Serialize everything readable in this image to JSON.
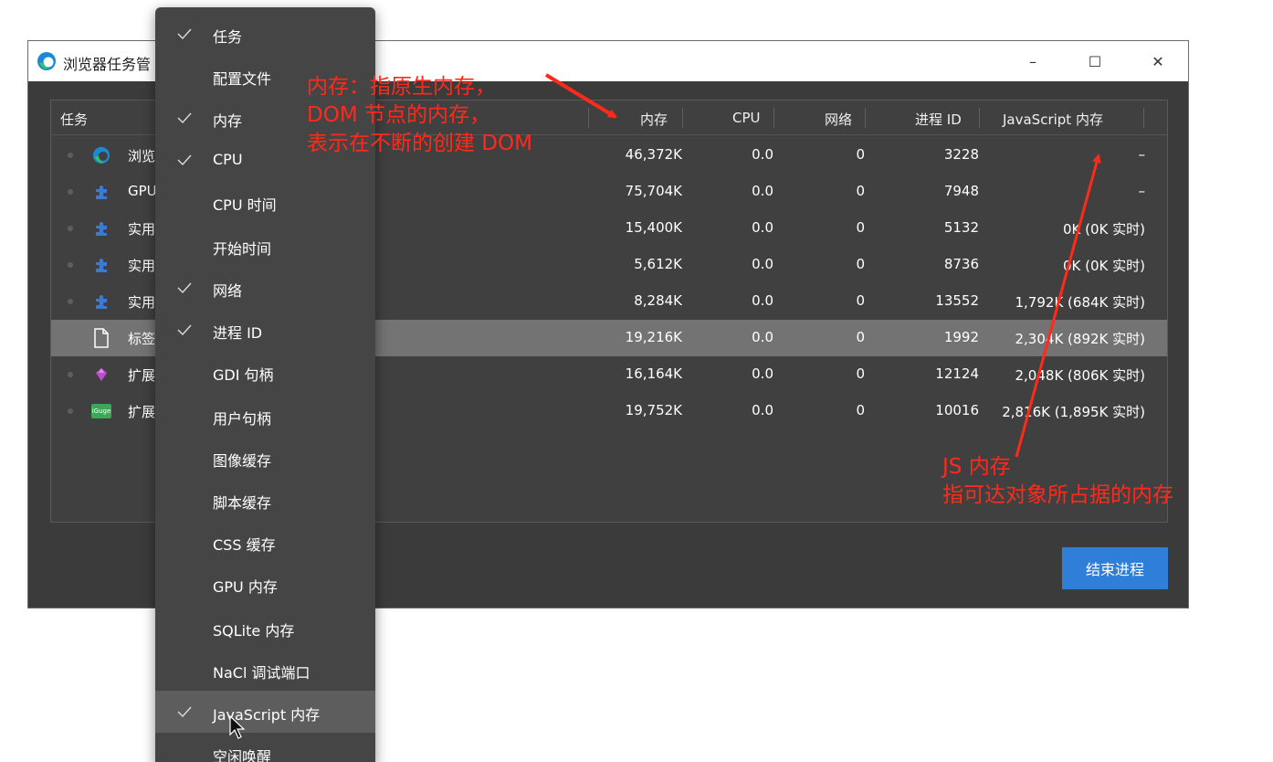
{
  "window": {
    "title": "浏览器任务管",
    "controls": {
      "minimize": "–",
      "maximize": "☐",
      "close": "✕"
    }
  },
  "table": {
    "headers": {
      "task": "任务",
      "memory": "内存",
      "cpu": "CPU",
      "network": "网络",
      "pid": "进程 ID",
      "js_memory": "JavaScript 内存"
    },
    "rows": [
      {
        "task": "浏览",
        "icon": "edge-icon",
        "memory": "46,372K",
        "cpu": "0.0",
        "network": "0",
        "pid": "3228",
        "js": "–"
      },
      {
        "task": "GPU",
        "icon": "puzzle-icon",
        "memory": "75,704K",
        "cpu": "0.0",
        "network": "0",
        "pid": "7948",
        "js": "–"
      },
      {
        "task": "实用",
        "icon": "puzzle-icon",
        "memory": "15,400K",
        "cpu": "0.0",
        "network": "0",
        "pid": "5132",
        "js": "0K (0K 实时)"
      },
      {
        "task": "实用",
        "icon": "puzzle-icon",
        "memory": "5,612K",
        "cpu": "0.0",
        "network": "0",
        "pid": "8736",
        "js": "0K (0K 实时)"
      },
      {
        "task": "实用",
        "icon": "puzzle-icon",
        "memory": "8,284K",
        "cpu": "0.0",
        "network": "0",
        "pid": "13552",
        "js": "1,792K (684K 实时)"
      },
      {
        "task": "标签",
        "icon": "page-icon",
        "memory": "19,216K",
        "cpu": "0.0",
        "network": "0",
        "pid": "1992",
        "js": "2,304K (892K 实时)",
        "selected": true
      },
      {
        "task": "扩展",
        "icon": "extension-gem-icon",
        "memory": "16,164K",
        "cpu": "0.0",
        "network": "0",
        "pid": "12124",
        "js": "2,048K (806K 实时)"
      },
      {
        "task": "扩展",
        "icon": "iguge-icon",
        "memory": "19,752K",
        "cpu": "0.0",
        "network": "0",
        "pid": "10016",
        "js": "2,816K (1,895K 实时)"
      }
    ],
    "iguge_label": "iGuge"
  },
  "end_process_button": "结束进程",
  "menu": {
    "items": [
      {
        "label": "任务",
        "checked": true
      },
      {
        "label": "配置文件",
        "checked": false
      },
      {
        "label": "内存",
        "checked": true
      },
      {
        "label": "CPU",
        "checked": true
      },
      {
        "label": "CPU 时间",
        "checked": false
      },
      {
        "label": "开始时间",
        "checked": false
      },
      {
        "label": "网络",
        "checked": true
      },
      {
        "label": "进程 ID",
        "checked": true
      },
      {
        "label": "GDI 句柄",
        "checked": false
      },
      {
        "label": "用户句柄",
        "checked": false
      },
      {
        "label": "图像缓存",
        "checked": false
      },
      {
        "label": "脚本缓存",
        "checked": false
      },
      {
        "label": "CSS 缓存",
        "checked": false
      },
      {
        "label": "GPU 内存",
        "checked": false
      },
      {
        "label": "SQLite 内存",
        "checked": false
      },
      {
        "label": "NaCl 调试端口",
        "checked": false
      },
      {
        "label": "JavaScript 内存",
        "checked": true,
        "hovered": true
      },
      {
        "label": "空闲唤醒",
        "checked": false
      }
    ]
  },
  "annotations": {
    "memory_note": [
      "内存：指原生内存，",
      "DOM 节点的内存，",
      "表示在不断的创建 DOM"
    ],
    "js_note": [
      "JS 内存",
      "指可达对象所占据的内存"
    ],
    "color": "#ff2a1a"
  },
  "colors": {
    "window_bg": "#3b3b3b",
    "panel_bg": "#404040",
    "menu_bg": "#454545",
    "selected_row": "#737373",
    "accent_button": "#2f7ed8"
  }
}
